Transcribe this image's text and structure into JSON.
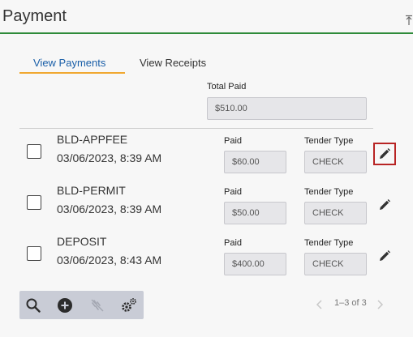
{
  "header": {
    "title": "Payment",
    "collapse_icon": "collapse-up-icon"
  },
  "tabs": [
    {
      "label": "View Payments",
      "active": true
    },
    {
      "label": "View Receipts",
      "active": false
    }
  ],
  "total_paid": {
    "label": "Total Paid",
    "value": "$510.00"
  },
  "rows": [
    {
      "code": "BLD-APPFEE",
      "datetime": "03/06/2023, 8:39 AM",
      "paid_label": "Paid",
      "paid": "$60.00",
      "tender_label": "Tender Type",
      "tender": "CHECK",
      "edit_icon": "pencil-icon"
    },
    {
      "code": "BLD-PERMIT",
      "datetime": "03/06/2023, 8:39 AM",
      "paid_label": "Paid",
      "paid": "$50.00",
      "tender_label": "Tender Type",
      "tender": "CHECK",
      "edit_icon": "pencil-icon"
    },
    {
      "code": "DEPOSIT",
      "datetime": "03/06/2023, 8:43 AM",
      "paid_label": "Paid",
      "paid": "$400.00",
      "tender_label": "Tender Type",
      "tender": "CHECK",
      "edit_icon": "pencil-icon"
    }
  ],
  "toolbar": {
    "icons": [
      "search-icon",
      "add-circle-icon",
      "remove-link-icon",
      "settings-gears-icon"
    ]
  },
  "pager": {
    "range": "1–3 of 3"
  },
  "colors": {
    "accent_underline": "#f0a830",
    "header_border": "#2e8b3a",
    "active_tab": "#1a5fa8",
    "selected_outline": "#b82424"
  }
}
